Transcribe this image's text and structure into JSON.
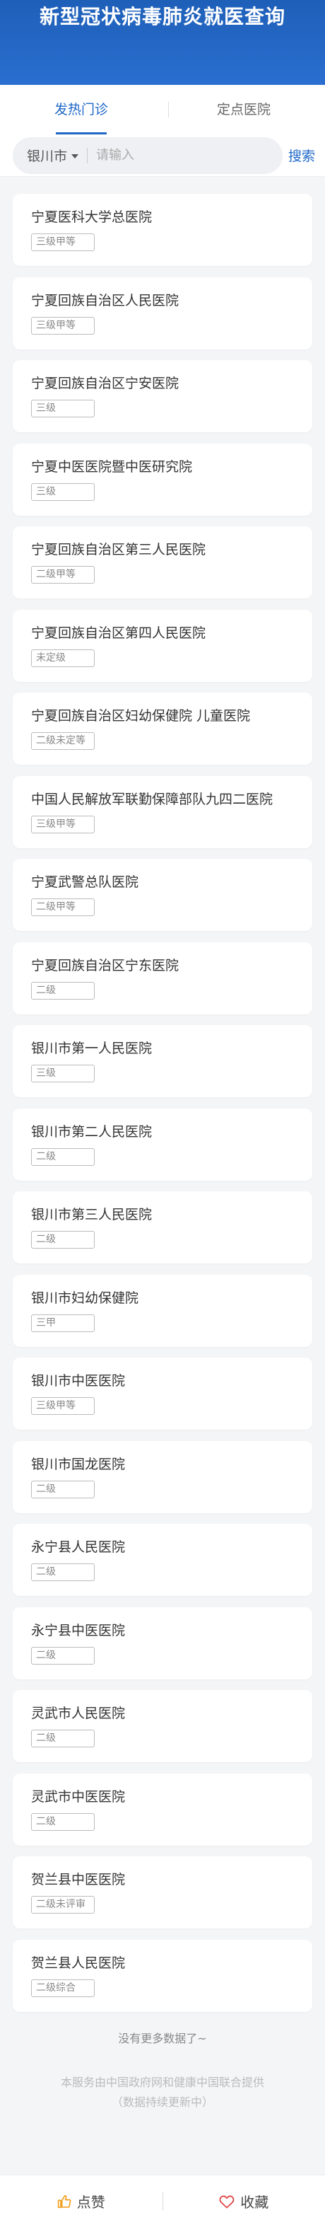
{
  "header": {
    "title": "新型冠状病毒肺炎就医查询"
  },
  "tabs": [
    {
      "label": "发热门诊"
    },
    {
      "label": "定点医院"
    }
  ],
  "search": {
    "city": "银川市",
    "placeholder": "请输入",
    "button": "搜索"
  },
  "hospitals": [
    {
      "name": "宁夏医科大学总医院",
      "level": "三级甲等"
    },
    {
      "name": "宁夏回族自治区人民医院",
      "level": "三级甲等"
    },
    {
      "name": "宁夏回族自治区宁安医院",
      "level": "三级"
    },
    {
      "name": "宁夏中医医院暨中医研究院",
      "level": "三级"
    },
    {
      "name": "宁夏回族自治区第三人民医院",
      "level": "二级甲等"
    },
    {
      "name": "宁夏回族自治区第四人民医院",
      "level": "未定级"
    },
    {
      "name": "宁夏回族自治区妇幼保健院 儿童医院",
      "level": "二级未定等"
    },
    {
      "name": "中国人民解放军联勤保障部队九四二医院",
      "level": "三级甲等"
    },
    {
      "name": "宁夏武警总队医院",
      "level": "二级甲等"
    },
    {
      "name": "宁夏回族自治区宁东医院",
      "level": "二级"
    },
    {
      "name": "银川市第一人民医院",
      "level": "三级"
    },
    {
      "name": "银川市第二人民医院",
      "level": "二级"
    },
    {
      "name": "银川市第三人民医院",
      "level": "二级"
    },
    {
      "name": "银川市妇幼保健院",
      "level": "三甲"
    },
    {
      "name": "银川市中医医院",
      "level": "三级甲等"
    },
    {
      "name": "银川市国龙医院",
      "level": "二级"
    },
    {
      "name": "永宁县人民医院",
      "level": "二级"
    },
    {
      "name": "永宁县中医医院",
      "level": "二级"
    },
    {
      "name": "灵武市人民医院",
      "level": "二级"
    },
    {
      "name": "灵武市中医医院",
      "level": "二级"
    },
    {
      "name": "贺兰县中医医院",
      "level": "二级未评审"
    },
    {
      "name": "贺兰县人民医院",
      "level": "二级综合"
    }
  ],
  "no_more": "没有更多数据了~",
  "notice": [
    "本服务由中国政府网和健康中国联合提供",
    "（数据持续更新中）"
  ],
  "footer": {
    "like": "点赞",
    "favorite": "收藏"
  },
  "colors": {
    "brand": "#1e67c8",
    "header_bg": "#2a6fd0",
    "like_icon": "#f0a020",
    "favorite_icon": "#e04b4b"
  },
  "icons": {
    "like": "thumbs-up-icon",
    "favorite": "heart-icon",
    "city_dropdown": "caret-down-icon"
  }
}
